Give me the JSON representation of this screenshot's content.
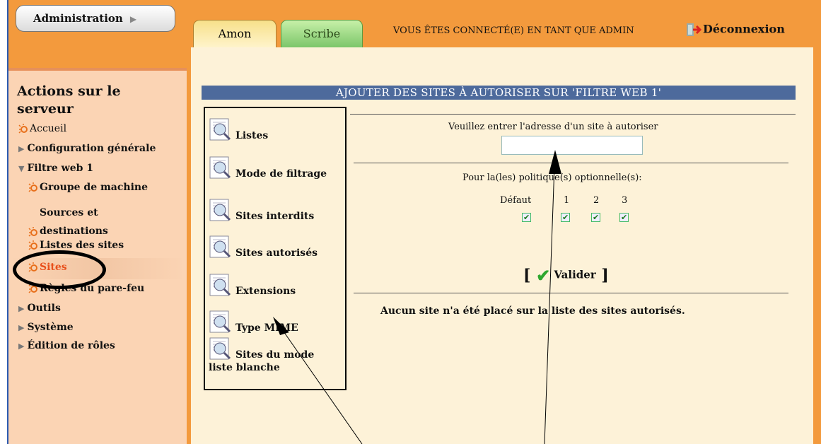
{
  "header": {
    "admin_button": "Administration",
    "tabs": [
      {
        "label": "Amon"
      },
      {
        "label": "Scribe"
      }
    ],
    "status": "VOUS ÊTES CONNECTÉ(E) EN TANT QUE ADMIN",
    "logout": "Déconnexion"
  },
  "sidebar": {
    "title": "Actions sur le serveur",
    "items": [
      {
        "label": "Accueil",
        "icon": "sun-icon"
      },
      {
        "label": "Configuration générale",
        "icon": "triangle-right-icon"
      },
      {
        "label": "Filtre web 1",
        "icon": "triangle-down-icon"
      },
      {
        "label": "Groupe de machine",
        "icon": "sun-icon"
      },
      {
        "label": "Sources et destinations",
        "icon": "sun-icon"
      },
      {
        "label": "Listes des sites",
        "icon": "sun-icon"
      },
      {
        "label": "Sites",
        "icon": "sun-icon",
        "selected": true
      },
      {
        "label": "Règles du pare-feu",
        "icon": "sun-icon"
      },
      {
        "label": "Outils",
        "icon": "triangle-right-icon"
      },
      {
        "label": "Système",
        "icon": "triangle-right-icon"
      },
      {
        "label": "Édition de rôles",
        "icon": "triangle-right-icon"
      }
    ]
  },
  "main": {
    "heading": "AJOUTER DES SITES À AUTORISER SUR 'FILTRE WEB 1'",
    "menu": [
      {
        "label": "Listes"
      },
      {
        "label": "Mode de filtrage"
      },
      {
        "label": "Sites interdits"
      },
      {
        "label": "Sites autorisés",
        "selected": true
      },
      {
        "label": "Extensions"
      },
      {
        "label": "Type MIME"
      },
      {
        "label": "Sites du mode liste blanche"
      }
    ],
    "prompt": "Veuillez entrer l'adresse d'un site à autoriser",
    "site_input": {
      "value": "",
      "placeholder": ""
    },
    "policy_label": "Pour la(les) politique(s) optionnelle(s):",
    "policies": [
      {
        "label": "Défaut",
        "checked": true
      },
      {
        "label": "1",
        "checked": true
      },
      {
        "label": "2",
        "checked": true
      },
      {
        "label": "3",
        "checked": true
      }
    ],
    "validate": "Valider",
    "empty_message": "Aucun site n'a été placé sur la liste des sites autorisés."
  },
  "colors": {
    "orange": "#f39a3d",
    "peach": "#fbd4b4",
    "cream": "#fdf2d8",
    "heading_bg": "#4d6a9c",
    "selected_text": "#e8501c"
  }
}
